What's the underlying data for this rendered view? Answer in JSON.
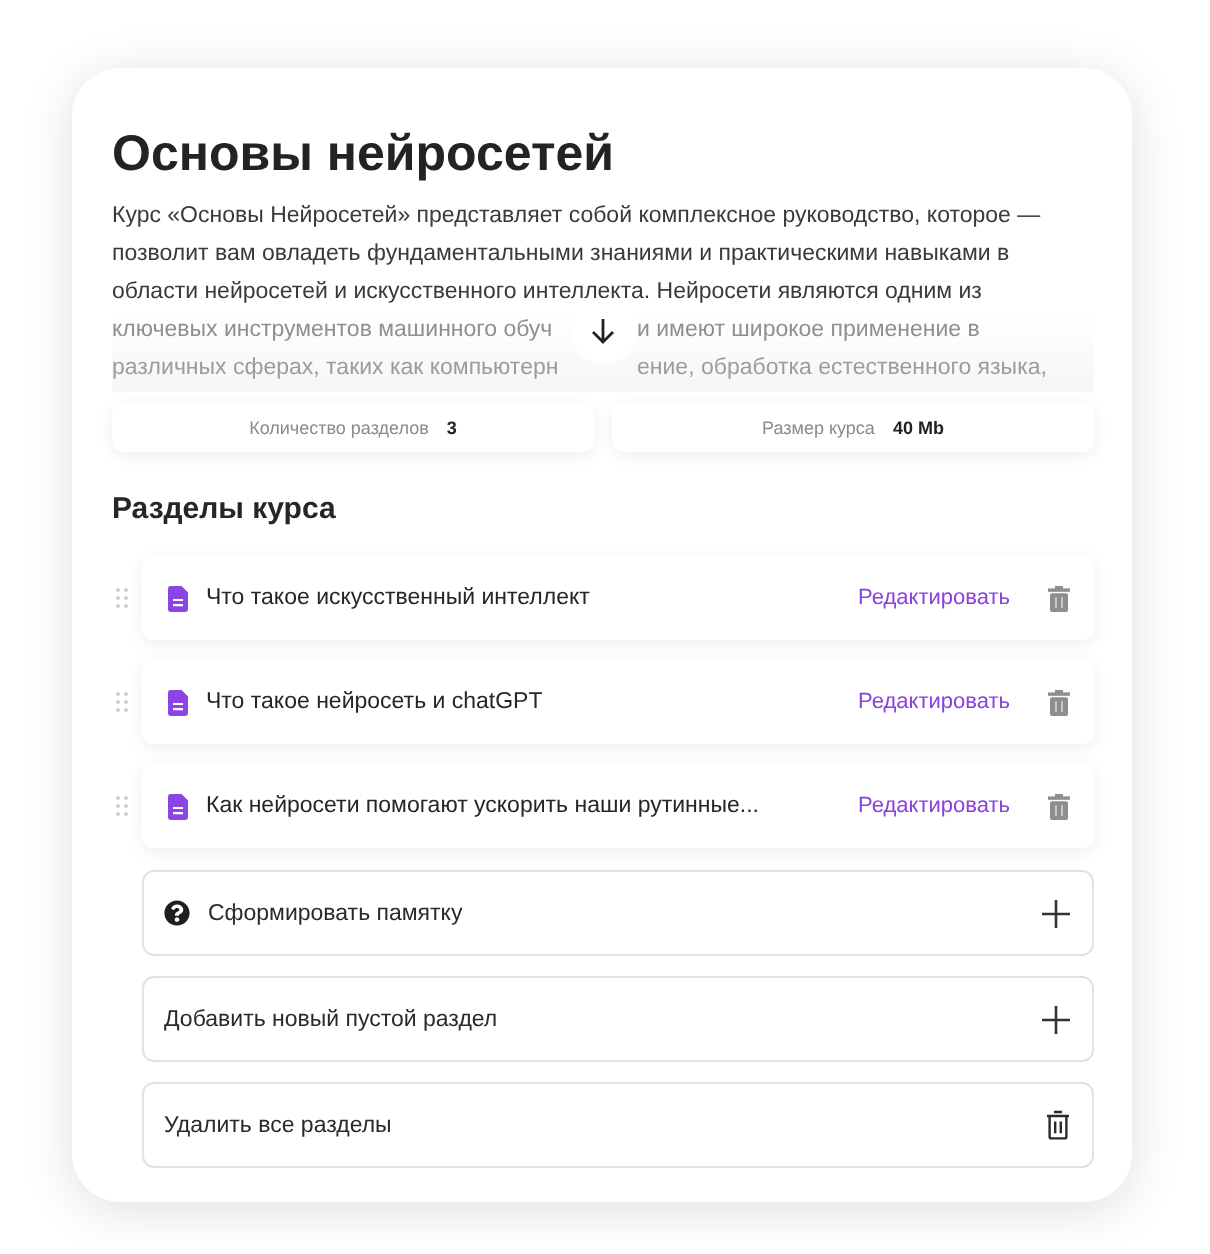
{
  "title": "Основы нейросетей",
  "description": {
    "lines": [
      "Курс «Основы Нейросетей» представляет собой комплексное руководство, которое —",
      "позволит вам овладеть фундаментальными знаниями и практическими навыками в",
      "области нейросетей и искусственного интеллекта. Нейросети являются одним из"
    ],
    "faded_lines": [
      {
        "left": "ключевых инструментов машинного обуч",
        "right": "и имеют широкое применение в"
      },
      {
        "left": "различных сферах, таких как компьютерн",
        "right": "ение, обработка естественного языка,"
      }
    ]
  },
  "stats": [
    {
      "label": "Количество разделов",
      "value": "3"
    },
    {
      "label": "Размер курса",
      "value": "40 Mb"
    }
  ],
  "sections_heading": "Разделы курса",
  "sections": [
    {
      "title": "Что такое искусственный интеллект",
      "action": "Редактировать"
    },
    {
      "title": "Что такое нейросеть и chatGPT",
      "action": "Редактировать"
    },
    {
      "title": "Как нейросети помогают ускорить наши рутинные...",
      "action": "Редактировать"
    }
  ],
  "actions": [
    {
      "kind": "generate",
      "label": "Сформировать памятку"
    },
    {
      "kind": "add",
      "label": "Добавить новый пустой раздел"
    },
    {
      "kind": "delete_all",
      "label": "Удалить все разделы"
    }
  ]
}
